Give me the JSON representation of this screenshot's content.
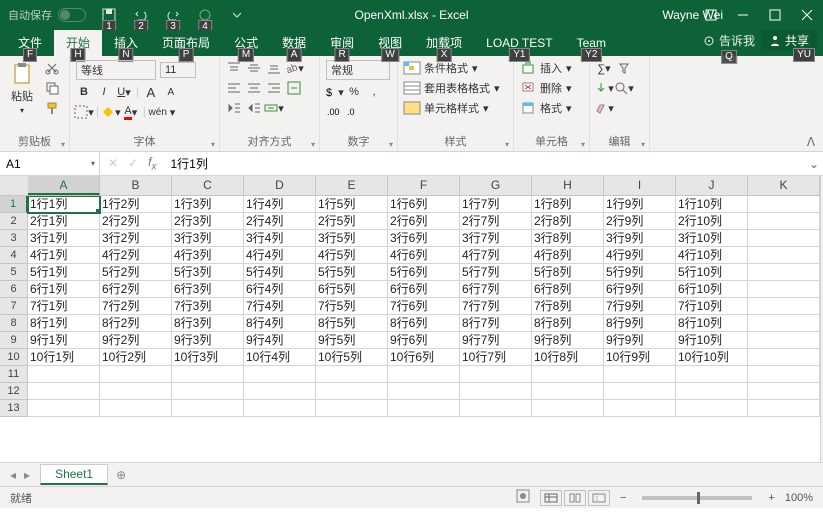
{
  "titlebar": {
    "autosave": "自动保存",
    "filename": "OpenXml.xlsx - Excel",
    "username": "Wayne Wei"
  },
  "ribbon": {
    "tabs": [
      {
        "label": "文件",
        "key": "F"
      },
      {
        "label": "开始",
        "key": "H",
        "active": true
      },
      {
        "label": "插入",
        "key": "N"
      },
      {
        "label": "页面布局",
        "key": "P"
      },
      {
        "label": "公式",
        "key": "M"
      },
      {
        "label": "数据",
        "key": "A"
      },
      {
        "label": "审阅",
        "key": "R"
      },
      {
        "label": "视图",
        "key": "W"
      },
      {
        "label": "加载项",
        "key": "X"
      },
      {
        "label": "LOAD TEST",
        "key": "Y1"
      },
      {
        "label": "Team",
        "key": "Y2"
      }
    ],
    "tellme": "告诉我",
    "tellme_key": "Q",
    "share": "共享",
    "share_key": "YU"
  },
  "groups": {
    "clipboard": {
      "label": "剪贴板",
      "paste": "粘贴"
    },
    "font": {
      "label": "字体",
      "fontname": "等线",
      "fontsize": "11",
      "wen": "wén",
      "a1": "A",
      "a2": "A"
    },
    "align": {
      "label": "对齐方式"
    },
    "number": {
      "label": "数字",
      "format": "常规"
    },
    "styles": {
      "label": "样式",
      "cond": "条件格式",
      "table": "套用表格格式",
      "cell": "单元格样式"
    },
    "cells": {
      "label": "单元格",
      "insert": "插入",
      "delete": "删除",
      "format": "格式"
    },
    "editing": {
      "label": "编辑"
    }
  },
  "namebox": "A1",
  "formula": "1行1列",
  "columns": [
    "A",
    "B",
    "C",
    "D",
    "E",
    "F",
    "G",
    "H",
    "I",
    "J",
    "K"
  ],
  "row_numbers": [
    1,
    2,
    3,
    4,
    5,
    6,
    7,
    8,
    9,
    10,
    11,
    12,
    13
  ],
  "chart_data": {
    "type": "table",
    "rows": [
      [
        "1行1列",
        "1行2列",
        "1行3列",
        "1行4列",
        "1行5列",
        "1行6列",
        "1行7列",
        "1行8列",
        "1行9列",
        "1行10列",
        ""
      ],
      [
        "2行1列",
        "2行2列",
        "2行3列",
        "2行4列",
        "2行5列",
        "2行6列",
        "2行7列",
        "2行8列",
        "2行9列",
        "2行10列",
        ""
      ],
      [
        "3行1列",
        "3行2列",
        "3行3列",
        "3行4列",
        "3行5列",
        "3行6列",
        "3行7列",
        "3行8列",
        "3行9列",
        "3行10列",
        ""
      ],
      [
        "4行1列",
        "4行2列",
        "4行3列",
        "4行4列",
        "4行5列",
        "4行6列",
        "4行7列",
        "4行8列",
        "4行9列",
        "4行10列",
        ""
      ],
      [
        "5行1列",
        "5行2列",
        "5行3列",
        "5行4列",
        "5行5列",
        "5行6列",
        "5行7列",
        "5行8列",
        "5行9列",
        "5行10列",
        ""
      ],
      [
        "6行1列",
        "6行2列",
        "6行3列",
        "6行4列",
        "6行5列",
        "6行6列",
        "6行7列",
        "6行8列",
        "6行9列",
        "6行10列",
        ""
      ],
      [
        "7行1列",
        "7行2列",
        "7行3列",
        "7行4列",
        "7行5列",
        "7行6列",
        "7行7列",
        "7行8列",
        "7行9列",
        "7行10列",
        ""
      ],
      [
        "8行1列",
        "8行2列",
        "8行3列",
        "8行4列",
        "8行5列",
        "8行6列",
        "8行7列",
        "8行8列",
        "8行9列",
        "8行10列",
        ""
      ],
      [
        "9行1列",
        "9行2列",
        "9行3列",
        "9行4列",
        "9行5列",
        "9行6列",
        "9行7列",
        "9行8列",
        "9行9列",
        "9行10列",
        ""
      ],
      [
        "10行1列",
        "10行2列",
        "10行3列",
        "10行4列",
        "10行5列",
        "10行6列",
        "10行7列",
        "10行8列",
        "10行9列",
        "10行10列",
        ""
      ],
      [
        "",
        "",
        "",
        "",
        "",
        "",
        "",
        "",
        "",
        "",
        ""
      ],
      [
        "",
        "",
        "",
        "",
        "",
        "",
        "",
        "",
        "",
        "",
        ""
      ],
      [
        "",
        "",
        "",
        "",
        "",
        "",
        "",
        "",
        "",
        "",
        ""
      ]
    ]
  },
  "sheet_tab": "Sheet1",
  "status": {
    "ready": "就绪",
    "zoom": "100%"
  }
}
